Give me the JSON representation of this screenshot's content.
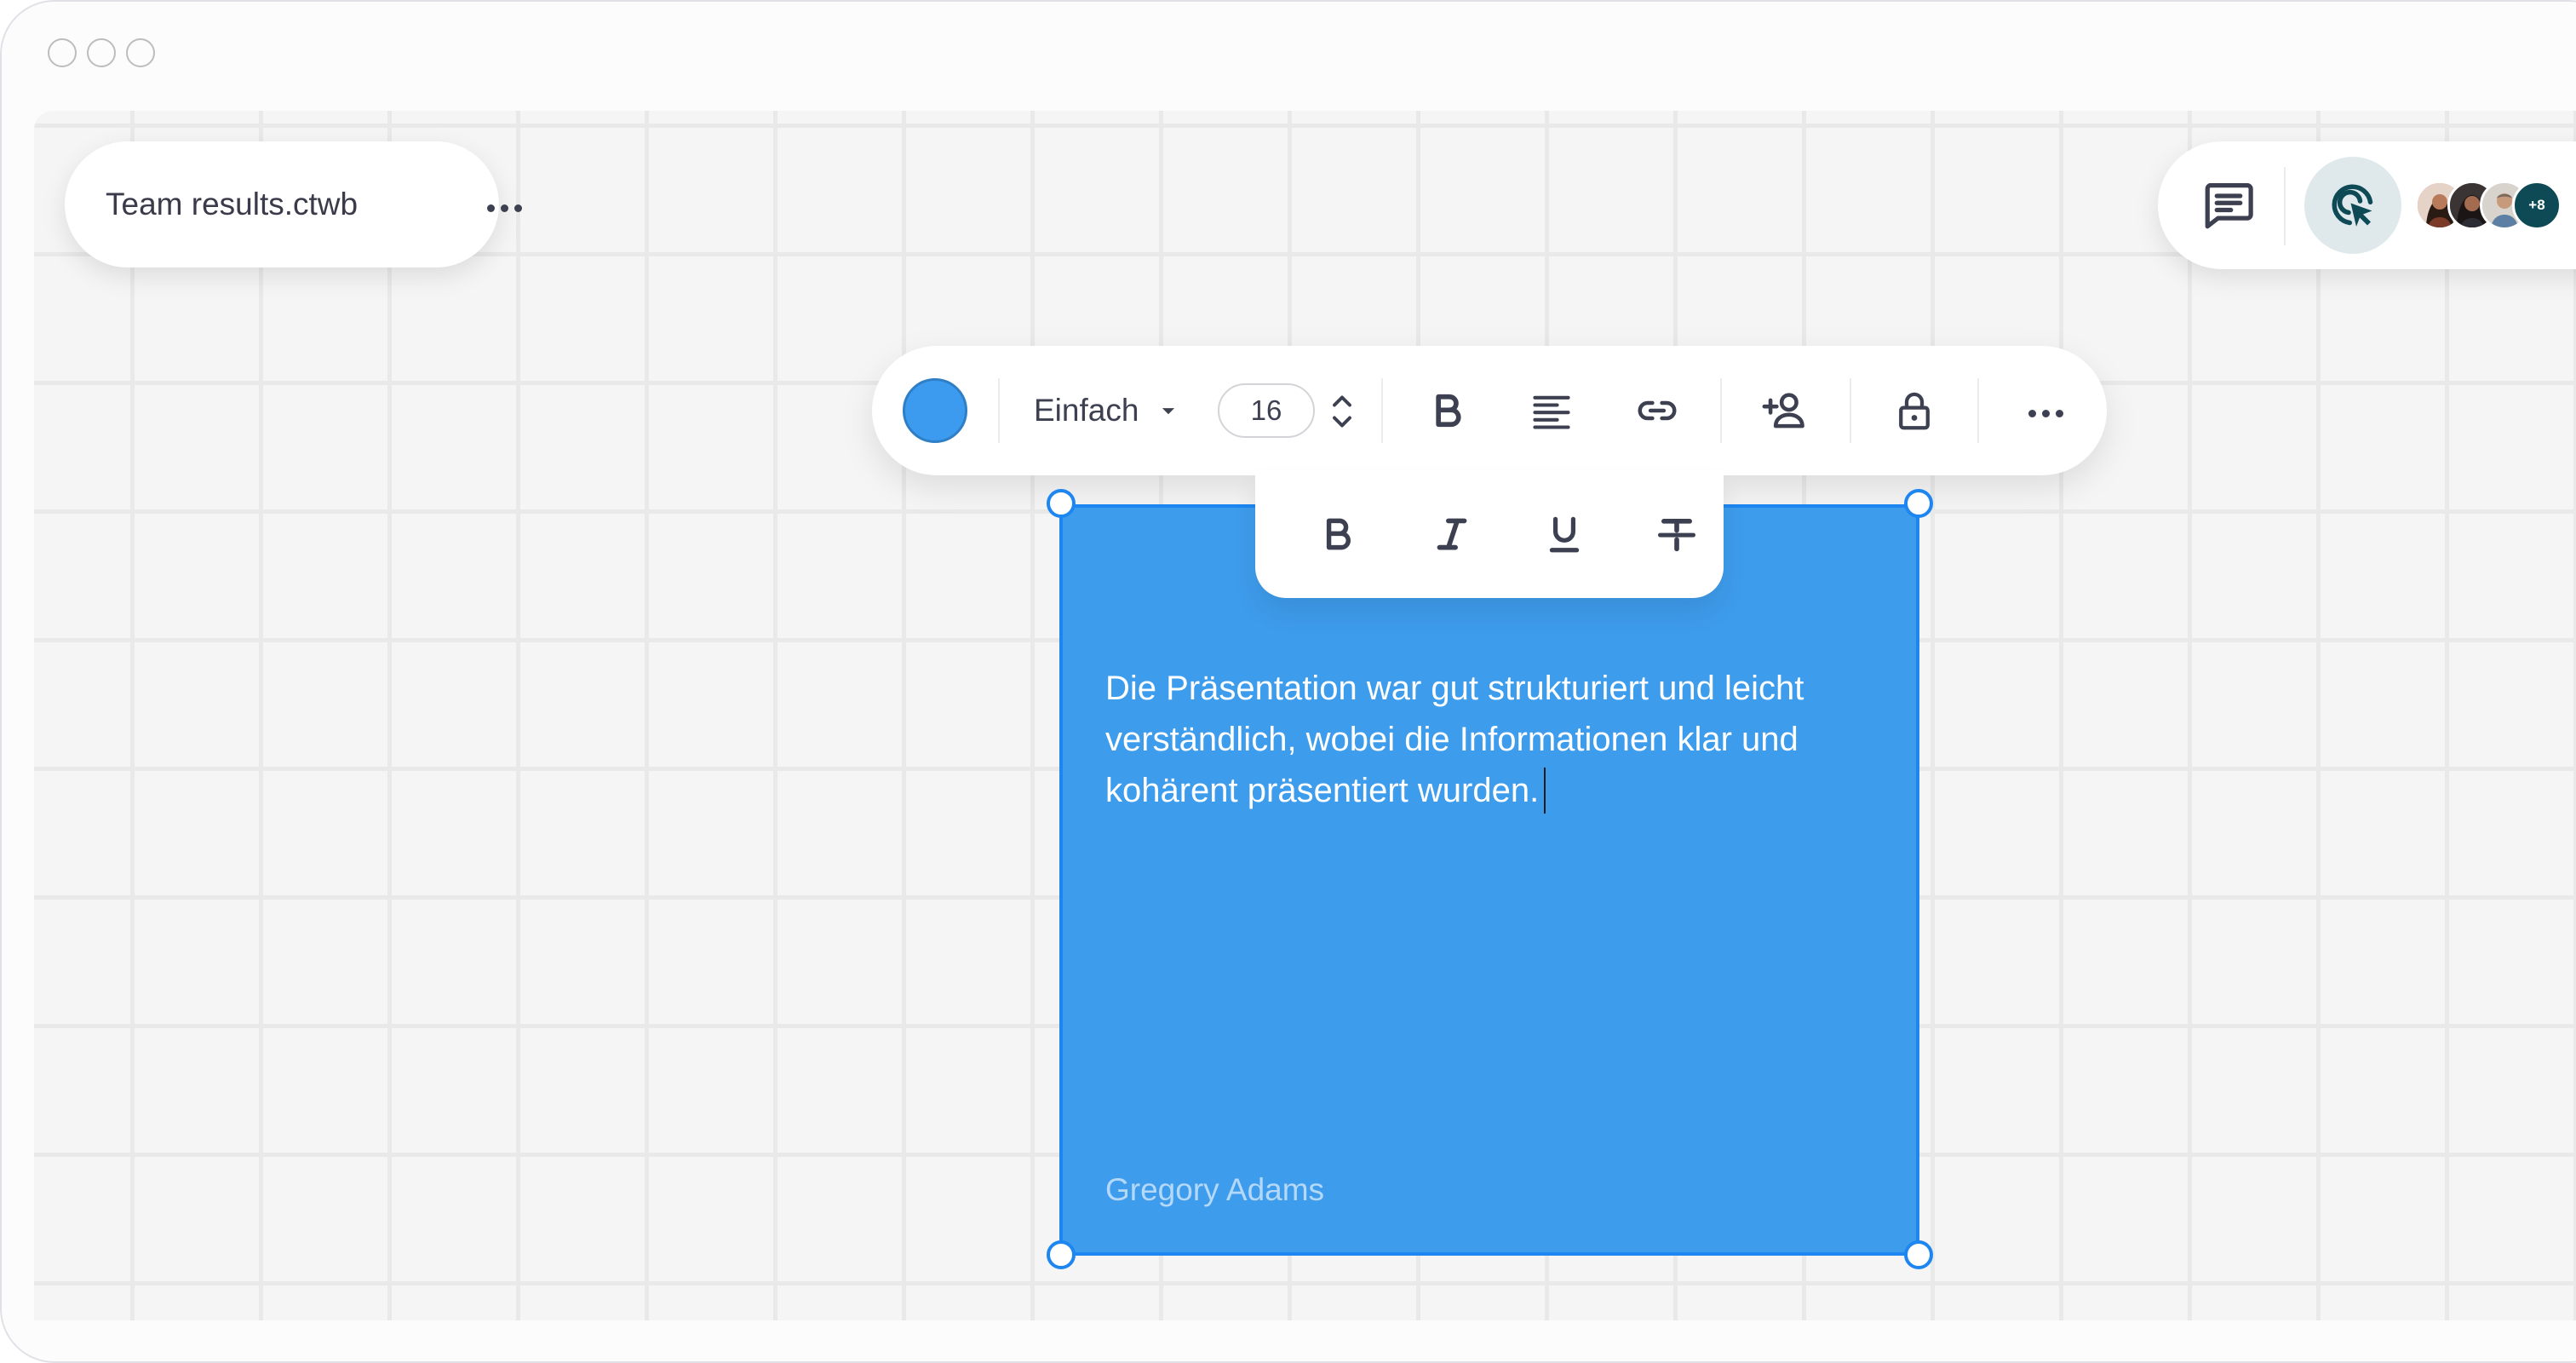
{
  "window": {
    "traffic_lights": [
      "close-light",
      "minimize-light",
      "maximize-light"
    ]
  },
  "file": {
    "name": "Team results.ctwb",
    "more_icon": "more-horizontal-icon"
  },
  "collab_bar": {
    "comment_icon": "comment-icon",
    "cursor_icon": "cursor-tracking-icon",
    "extra_collaborators": "+8",
    "avatar_count_visible": 3
  },
  "toolbar": {
    "color": "#3d9bef",
    "font_style": "Einfach",
    "font_size": "16",
    "tools": [
      "color-swatch",
      "font-style-select",
      "font-size-input",
      "size-stepper-icon",
      "bold-icon",
      "align-text-icon",
      "link-icon",
      "add-user-icon",
      "lock-icon",
      "more-horizontal-icon"
    ]
  },
  "format_popover": {
    "tools": [
      "bold-icon",
      "italic-icon",
      "underline-icon",
      "strikethrough-icon"
    ]
  },
  "sticky_note": {
    "text": "Die Präsentation war gut strukturiert und leicht verständlich, wobei die Informationen klar und kohärent präsentiert wurden.",
    "author": "Gregory Adams",
    "background_color": "#3e9cec",
    "selection_color": "#1e86f0"
  },
  "colors": {
    "canvas_bg": "#f5f5f5",
    "grid_line": "#e9e9e9",
    "icon": "#3d4050",
    "cursor_button_bg": "#dfe9ec",
    "avatar_more_bg": "#0e4a56"
  }
}
